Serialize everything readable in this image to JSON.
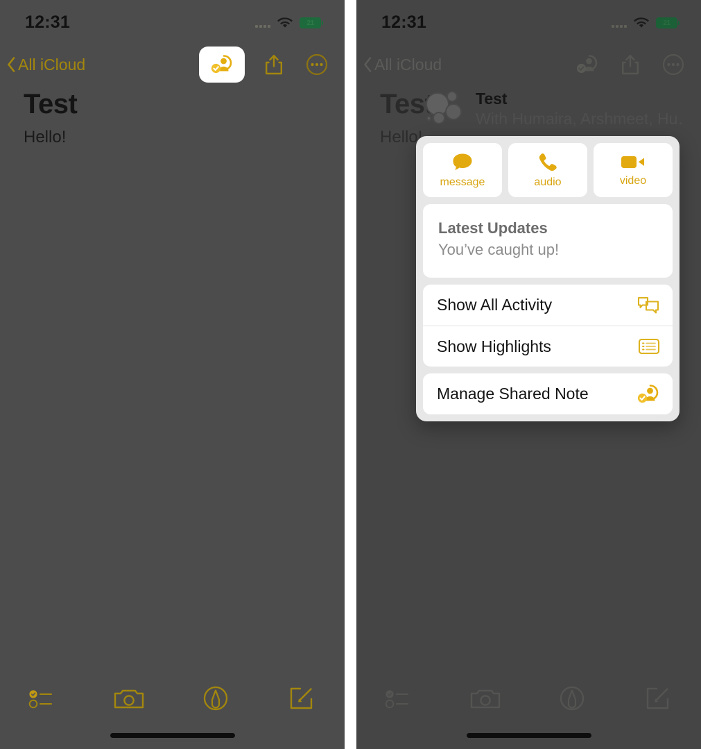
{
  "accent": "#e0aa0f",
  "accent_dim": "#a3870d",
  "panel_bg": "#4c4c4c",
  "status_bar": {
    "time": "12:31",
    "signal_icon": "cellular-bars-icon",
    "wifi_icon": "wifi-icon",
    "battery_icon": "battery-icon",
    "battery_level": "21"
  },
  "nav": {
    "back_label": "All iCloud",
    "back_icon": "chevron-left-icon",
    "collaborate_icon": "shared-note-collaborate-icon",
    "share_icon": "share-icon",
    "more_icon": "more-ellipsis-circle-icon"
  },
  "note": {
    "title": "Test",
    "body": "Hello!"
  },
  "toolbar": {
    "items": [
      {
        "icon": "checklist-icon",
        "label": "Checklist"
      },
      {
        "icon": "camera-icon",
        "label": "Camera"
      },
      {
        "icon": "markup-pen-circle-icon",
        "label": "Markup"
      },
      {
        "icon": "compose-new-note-icon",
        "label": "New Note"
      }
    ]
  },
  "popover": {
    "header": {
      "avatar_icon": "participants-avatar-cluster-icon",
      "title": "Test",
      "subtitle": "With Humaira, Arshmeet, Hu…"
    },
    "tiles": [
      {
        "label": "message",
        "icon": "message-bubble-icon"
      },
      {
        "label": "audio",
        "icon": "phone-handset-icon"
      },
      {
        "label": "video",
        "icon": "video-camera-icon"
      }
    ],
    "updates": {
      "title": "Latest Updates",
      "subtitle": "You’ve caught up!"
    },
    "menu": [
      {
        "label": "Show All Activity",
        "icon": "activity-bubbles-icon"
      },
      {
        "label": "Show Highlights",
        "icon": "highlights-list-icon"
      }
    ],
    "manage": {
      "label": "Manage Shared Note",
      "icon": "shared-note-collaborate-icon"
    }
  }
}
